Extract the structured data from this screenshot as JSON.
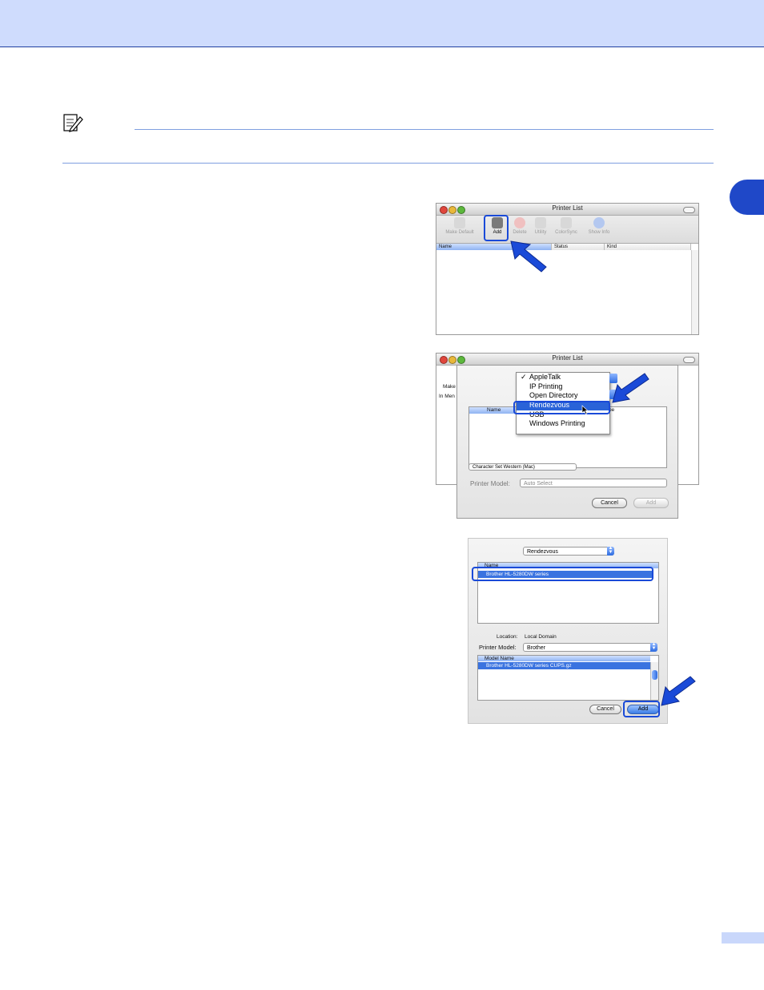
{
  "note": {
    "icon": "note-pencil-icon"
  },
  "screen1": {
    "title": "Printer List",
    "toolbar": [
      "Make Default",
      "Add",
      "Delete",
      "Utility",
      "ColorSync",
      "Show Info"
    ],
    "columns": [
      "Name",
      "Status",
      "Kind"
    ]
  },
  "screen2": {
    "title": "Printer List",
    "behind_toolbar_label": "Make",
    "behind_list_text": "In Men",
    "menu": [
      "AppleTalk",
      "IP Printing",
      "Open Directory",
      "Rendezvous",
      "USB",
      "Windows Printing"
    ],
    "checked": "AppleTalk",
    "selected": "Rendezvous",
    "list_header": [
      "Name",
      "pe"
    ],
    "charset": "Character Set Western (Mac)",
    "printer_model_label": "Printer Model:",
    "printer_model_value": "Auto Select",
    "cancel": "Cancel",
    "add": "Add"
  },
  "screen3": {
    "connection": "Rendezvous",
    "list_header": "Name",
    "printer_row": "Brother HL-5280DW series",
    "location_label": "Location:",
    "location_value": "Local Domain",
    "printer_model_label": "Printer Model:",
    "printer_model_value": "Brother",
    "model_header": "Model Name",
    "model_row": "Brother HL-5280DW series CUPS.gz",
    "cancel": "Cancel",
    "add": "Add"
  },
  "colors": {
    "accent": "#1f48c8",
    "header_band": "#cfdcfd",
    "highlight": "#1a4ad8"
  }
}
